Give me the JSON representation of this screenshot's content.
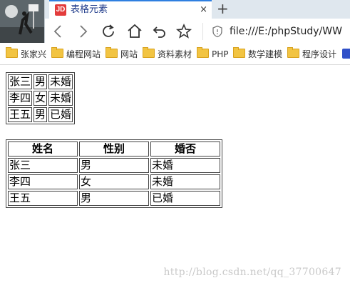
{
  "browser": {
    "tab": {
      "favicon": "JD",
      "title": "表格元素",
      "close": "×"
    },
    "new_tab": "+",
    "url": "file:///E:/phpStudy/WW",
    "bookmarks": [
      "张家兴",
      "编程网站",
      "网站",
      "资料素材",
      "PHP",
      "数学建模",
      "程序设计"
    ]
  },
  "page": {
    "table1": {
      "rows": [
        [
          "张三",
          "男",
          "未婚"
        ],
        [
          "李四",
          "女",
          "未婚"
        ],
        [
          "王五",
          "男",
          "已婚"
        ]
      ]
    },
    "table2": {
      "headers": [
        "姓名",
        "性别",
        "婚否"
      ],
      "rows": [
        [
          "张三",
          "男",
          "未婚"
        ],
        [
          "李四",
          "女",
          "未婚"
        ],
        [
          "王五",
          "男",
          "已婚"
        ]
      ]
    },
    "watermark": "http://blog.csdn.net/qq_37700647"
  },
  "colors": {
    "tab_accent": "#2f7fe0",
    "tabstrip_bg": "#dfe7ee",
    "folder": "#f2c442"
  },
  "icons": [
    "back-icon",
    "forward-icon",
    "reload-icon",
    "home-icon",
    "undo-icon",
    "star-icon",
    "shield-icon",
    "folder-icon"
  ]
}
